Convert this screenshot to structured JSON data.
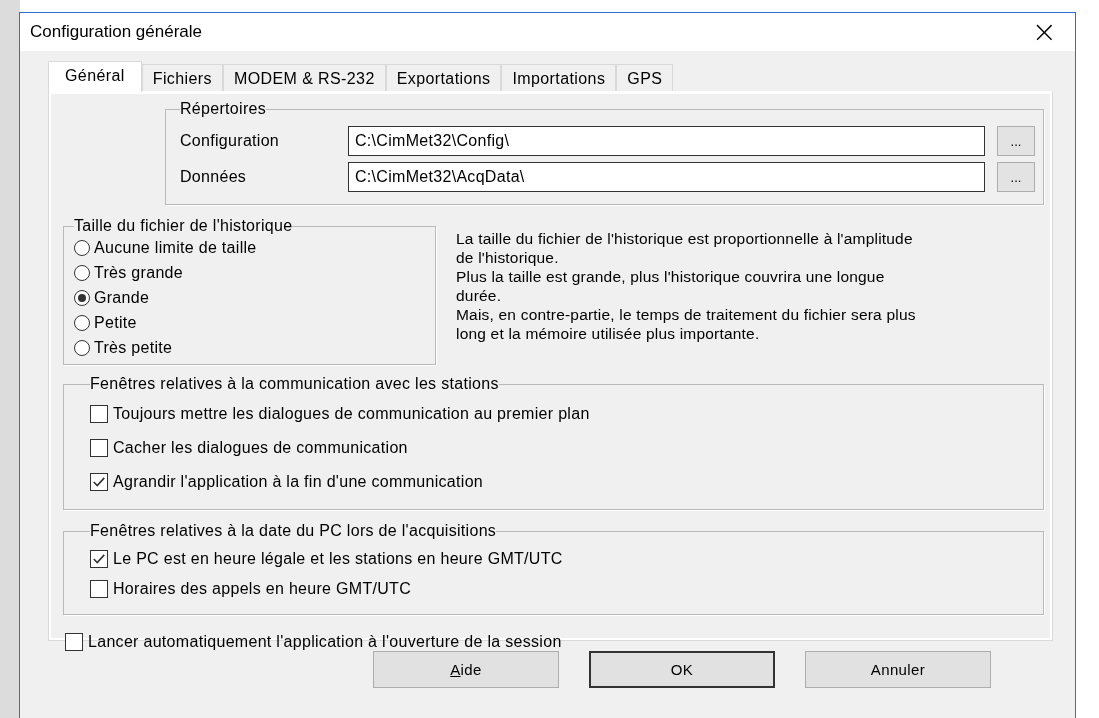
{
  "window": {
    "title": "Configuration générale",
    "close": "×"
  },
  "tabs": [
    {
      "label": "Général",
      "selected": true
    },
    {
      "label": "Fichiers",
      "selected": false
    },
    {
      "label": "MODEM & RS-232",
      "selected": false
    },
    {
      "label": "Exportations",
      "selected": false
    },
    {
      "label": "Importations",
      "selected": false
    },
    {
      "label": "GPS",
      "selected": false
    }
  ],
  "directories": {
    "title": "Répertoires",
    "rows": [
      {
        "label": "Configuration",
        "value": "C:\\CimMet32\\Config\\",
        "browse": "..."
      },
      {
        "label": "Données",
        "value": "C:\\CimMet32\\AcqData\\",
        "browse": "..."
      }
    ]
  },
  "history_size": {
    "title": "Taille du fichier de l'historique",
    "options": [
      {
        "label": "Aucune limite de taille",
        "selected": false
      },
      {
        "label": "Très grande",
        "selected": false
      },
      {
        "label": "Grande",
        "selected": true
      },
      {
        "label": "Petite",
        "selected": false
      },
      {
        "label": "Très petite",
        "selected": false
      }
    ],
    "description": "La taille du fichier de l'historique est proportionnelle à l'amplitude de l'historique.\nPlus la taille est grande, plus l'historique couvrira une longue durée.\nMais, en contre-partie, le temps de traitement du fichier sera plus long et la mémoire utilisée plus importante."
  },
  "communication": {
    "title": "Fenêtres relatives à la communication avec les stations",
    "options": [
      {
        "label": "Toujours mettre les dialogues de communication au premier plan",
        "checked": false
      },
      {
        "label": "Cacher les dialogues de communication",
        "checked": false
      },
      {
        "label": "Agrandir l'application à la fin d'une communication",
        "checked": true
      }
    ]
  },
  "pc_date": {
    "title": "Fenêtres relatives à la date du PC lors de l'acquisitions",
    "options": [
      {
        "label": "Le PC est en heure légale et les stations en heure GMT/UTC",
        "checked": true
      },
      {
        "label": "Horaires des appels en heure GMT/UTC",
        "checked": false
      }
    ]
  },
  "autostart": {
    "label": "Lancer automatiquement l'application à l'ouverture de la session",
    "checked": false
  },
  "buttons": [
    {
      "label": "Aide",
      "mnemonic": true,
      "default": false
    },
    {
      "label": "OK",
      "mnemonic": false,
      "default": true
    },
    {
      "label": "Annuler",
      "mnemonic": false,
      "default": false
    }
  ]
}
